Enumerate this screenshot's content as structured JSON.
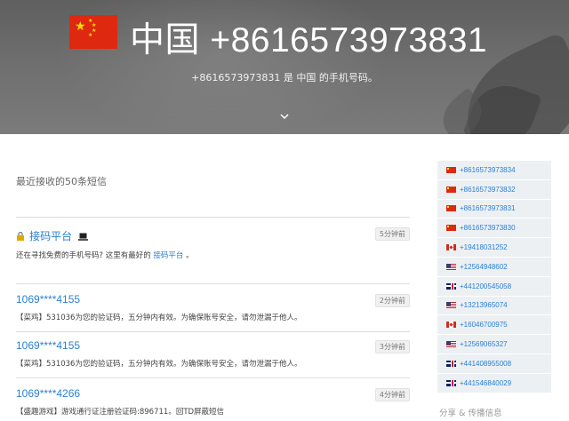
{
  "hero": {
    "title": "中国 +8616573973831",
    "subtitle": "+8616573973831 是 中国 的手机号码。",
    "flag_icon": "china-flag-icon",
    "scroll_icon": "chevron-down-icon"
  },
  "main": {
    "section_title": "最近接收的50条短信",
    "messages": [
      {
        "sender": "接码平台",
        "time": "5分钟前",
        "body_prefix": "还在寻找免费的手机号码? 这里有最好的 ",
        "body_link": "接码平台",
        "body_suffix": " 。",
        "icons": [
          "lock-icon",
          "laptop-icon"
        ]
      },
      {
        "sender": "1069****4155",
        "time": "2分钟前",
        "body": "【菜鸡】531036为您的验证码，五分钟内有效。为确保账号安全，请勿泄漏于他人。"
      },
      {
        "sender": "1069****4155",
        "time": "3分钟前",
        "body": "【菜鸡】531036为您的验证码，五分钟内有效。为确保账号安全，请勿泄漏于他人。"
      },
      {
        "sender": "1069****4266",
        "time": "4分钟前",
        "body": "【盛趣游戏】游戏通行证注册验证码:896711。回TD屏蔽短信"
      }
    ]
  },
  "sidebar": {
    "numbers": [
      {
        "flag": "cn",
        "number": "+8616573973834"
      },
      {
        "flag": "cn",
        "number": "+8616573973832"
      },
      {
        "flag": "cn",
        "number": "+8616573973831"
      },
      {
        "flag": "cn",
        "number": "+8616573973830"
      },
      {
        "flag": "ca",
        "number": "+19418031252"
      },
      {
        "flag": "us",
        "number": "+12564948602"
      },
      {
        "flag": "uk",
        "number": "+441200545058"
      },
      {
        "flag": "us",
        "number": "+13213965074"
      },
      {
        "flag": "ca",
        "number": "+16046700975"
      },
      {
        "flag": "us",
        "number": "+12569065327"
      },
      {
        "flag": "uk",
        "number": "+441408955008"
      },
      {
        "flag": "uk",
        "number": "+441546840029"
      }
    ],
    "footer": "分享 & 传播信息"
  }
}
